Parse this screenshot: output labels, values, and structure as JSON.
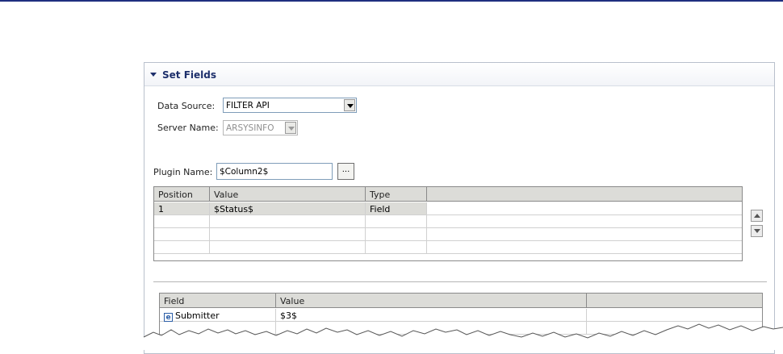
{
  "section": {
    "title": "Set Fields"
  },
  "form": {
    "data_source_label": "Data Source:",
    "data_source_value": "FILTER API",
    "server_name_label": "Server Name:",
    "server_name_value": "ARSYSINFO",
    "plugin_name_label": "Plugin Name:",
    "plugin_name_value": "$Column2$",
    "browse_label": "..."
  },
  "input_table": {
    "headers": [
      "Position",
      "Value",
      "Type"
    ],
    "rows": [
      {
        "position": "1",
        "value": "$Status$",
        "type": "Field"
      }
    ]
  },
  "fields_table": {
    "headers": [
      "Field",
      "Value"
    ],
    "rows": [
      {
        "icon": "field-icon",
        "field": "Submitter",
        "value": "$3$"
      }
    ]
  },
  "icons": {
    "collapse": "triangle-down-icon",
    "move_up": "arrow-up-icon",
    "move_down": "arrow-down-icon",
    "field_type": "e-icon"
  },
  "colors": {
    "accent": "#1d2f6b",
    "header_bg": "#dcdcd8",
    "top_line": "#1f2f7f"
  }
}
